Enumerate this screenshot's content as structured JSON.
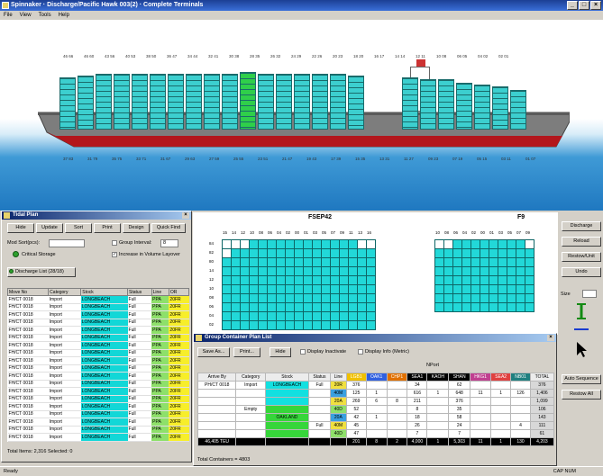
{
  "window": {
    "title": "Spinnaker · Discharge/Pacific Hawk 003(2) · Complete Terminals"
  },
  "menu": [
    "File",
    "View",
    "Tools",
    "Help"
  ],
  "ship": {
    "top_bays": [
      "46  66",
      "46  60",
      "43  56",
      "40  53",
      "38  50",
      "36  47",
      "34  44",
      "32  41",
      "30  38",
      "28  35",
      "26  32",
      "24  29",
      "22  26",
      "20  23",
      "18  20",
      "16  17",
      "14  14",
      "12  11",
      "10  08",
      "06  05",
      "04  02",
      "02  01"
    ],
    "bottom_bays": [
      "37  83",
      "31  79",
      "35  75",
      "33  71",
      "31  67",
      "29  63",
      "27  59",
      "25  55",
      "23  51",
      "21  47",
      "19  43",
      "17  39",
      "15  35",
      "13  31",
      "11  27",
      "09  23",
      "07  19",
      "05  15",
      "03  11",
      "01  07"
    ],
    "selected_bay_index": 10
  },
  "left_panel": {
    "title": "Tidal Plan",
    "buttons": [
      "Hide",
      "Update",
      "Sort",
      "Print",
      "Design",
      "Quick Find"
    ],
    "mod_label": "Mod Sort(pcs):",
    "group_label": "Group Interval:",
    "group_value": "8",
    "status_label": "Critical Storage",
    "checkbox_label": "Increase in Volume Layover",
    "tab_label": "Discharge List (28/18)",
    "table_headers": [
      "Move No",
      "Category",
      "Stock",
      "Status",
      "Line",
      "OR"
    ],
    "rows": [
      [
        "FH/CT 0018",
        "Import",
        "LONGBEACH",
        "Full",
        "PPA",
        "20FR"
      ],
      [
        "FH/CT 0018",
        "Import",
        "LONGBEACH",
        "Full",
        "PPA",
        "20FR"
      ],
      [
        "FH/CT 0018",
        "Import",
        "LONGBEACH",
        "Full",
        "PPA",
        "20FR"
      ],
      [
        "FH/CT 0018",
        "Import",
        "LONGBEACH",
        "Full",
        "PPA",
        "20FR"
      ],
      [
        "FH/CT 0018",
        "Import",
        "LONGBEACH",
        "Full",
        "PPA",
        "20FR"
      ],
      [
        "FH/CT 0018",
        "Import",
        "LONGBEACH",
        "Full",
        "PPA",
        "20FR"
      ],
      [
        "FH/CT 0018",
        "Import",
        "LONGBEACH",
        "Full",
        "PPA",
        "20FR"
      ],
      [
        "FH/CT 0018",
        "Import",
        "LONGBEACH",
        "Full",
        "PPA",
        "20FR"
      ],
      [
        "FH/CT 0018",
        "Import",
        "LONGBEACH",
        "Full",
        "PPA",
        "20FR"
      ],
      [
        "FH/CT 0018",
        "Import",
        "LONGBEACH",
        "Full",
        "PPA",
        "20FR"
      ],
      [
        "FH/CT 0018",
        "Import",
        "LONGBEACH",
        "Full",
        "PPA",
        "20FR"
      ],
      [
        "FH/CT 0018",
        "Import",
        "LONGBEACH",
        "Full",
        "PPA",
        "20FR"
      ],
      [
        "FH/CT 0018",
        "Import",
        "LONGBEACH",
        "Full",
        "PPA",
        "20FR"
      ],
      [
        "FH/CT 0018",
        "Import",
        "LONGBEACH",
        "Full",
        "PPA",
        "20FR"
      ],
      [
        "FH/CT 0018",
        "Import",
        "LONGBEACH",
        "Full",
        "PPA",
        "20FR"
      ],
      [
        "FH/CT 0018",
        "Import",
        "LONGBEACH",
        "Full",
        "PPA",
        "20FR"
      ],
      [
        "FH/CT 0018",
        "Import",
        "LONGBEACH",
        "Full",
        "PPA",
        "20FR"
      ],
      [
        "FH/CT 0018",
        "Import",
        "LONGBEACH",
        "Full",
        "PPA",
        "20FR"
      ],
      [
        "FH/CT 0018",
        "Import",
        "LONGBEACH",
        "Full",
        "PPA",
        "20FR"
      ]
    ],
    "footer": "Total Items: 2,316   Selected: 0"
  },
  "bayplan": {
    "left_label": "FSEP42",
    "right_label": "F9",
    "left_cols": [
      "15",
      "14",
      "12",
      "10",
      "08",
      "06",
      "04",
      "02",
      "00",
      "01",
      "03",
      "05",
      "07",
      "09",
      "11",
      "13",
      "16"
    ],
    "right_cols": [
      "10",
      "08",
      "06",
      "04",
      "02",
      "00",
      "01",
      "03",
      "05",
      "07",
      "09"
    ],
    "row_labels": [
      "84",
      "82",
      "80",
      "14",
      "12",
      "10",
      "08",
      "06",
      "04",
      "02"
    ]
  },
  "right_buttons": [
    "Discharge",
    "Reload",
    "Restow/Unit",
    "Undo",
    "Auto Sequence",
    "Restow All"
  ],
  "right_size_label": "Size",
  "detail": {
    "title": "Group Container Plan List",
    "buttons": [
      "Save As...",
      "Print...",
      "Hide"
    ],
    "checkbox1": "Display Inactivate",
    "checkbox2": "Display Info (Metric)",
    "header_group": "NPort",
    "headers": [
      "Arrive By",
      "Category",
      "Stock",
      "Status",
      "Line",
      "LGB1",
      "OAK1",
      "CHP1",
      "SEA1",
      "KAOH",
      "SHAN",
      "HKG1",
      "SEA2",
      "NB01",
      "TOTAL"
    ],
    "rows": [
      [
        "PH/CT 0018",
        "Import",
        "",
        "Full",
        "20R",
        "376",
        "",
        "",
        "34",
        "",
        "62",
        "",
        "",
        "",
        "376"
      ],
      [
        "",
        "",
        "",
        "",
        "40M",
        "125",
        "1",
        "",
        "616",
        "1",
        "648",
        "11",
        "1",
        "126",
        "1,406"
      ],
      [
        "",
        "",
        "",
        "",
        "20A",
        "269",
        "6",
        "8",
        "211",
        "",
        "376",
        "",
        "",
        "",
        "1,099"
      ],
      [
        "",
        "Empty",
        "",
        "",
        "40D",
        "52",
        "",
        "",
        "8",
        "",
        "35",
        "",
        "",
        "",
        "106"
      ],
      [
        "",
        "",
        "",
        "",
        "20A",
        "42",
        "1",
        "",
        "18",
        "",
        "58",
        "",
        "",
        "",
        "143"
      ],
      [
        "",
        "",
        "",
        "Full",
        "40M",
        "45",
        "",
        "",
        "26",
        "",
        "24",
        "",
        "",
        "4",
        "111"
      ],
      [
        "",
        "",
        "",
        "",
        "40D",
        "47",
        "",
        "",
        "7",
        "",
        "7",
        "",
        "",
        "",
        "61"
      ]
    ],
    "stock_labels": [
      "LONGBEACH",
      "OAKLAND"
    ],
    "total_row": [
      "46,405 TEU",
      "",
      "",
      "",
      "",
      "201",
      "8",
      "2",
      "4,000",
      "1",
      "5,303",
      "11",
      "1",
      "130",
      "4,203"
    ],
    "footer": "Total Containers = 4803"
  },
  "statusbar": {
    "left": "Ready",
    "right": "CAP    NUM"
  }
}
